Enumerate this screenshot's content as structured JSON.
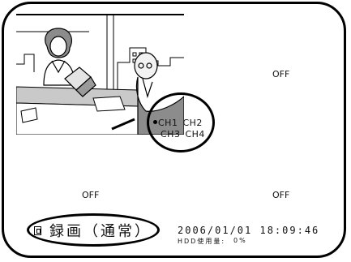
{
  "channels": {
    "ch2_status": "OFF",
    "ch3_status": "OFF",
    "ch4_status": "OFF",
    "selector": {
      "ch1": "CH1",
      "ch2": "CH2",
      "ch3": "CH3",
      "ch4": "CH4",
      "active": "CH1"
    }
  },
  "recording": {
    "icon": "recording-mode-icon",
    "mode_label": "録画（通常）"
  },
  "status_bar": {
    "datetime": "2006/01/01 18:09:46",
    "hdd_label": "HDD使用量:",
    "hdd_value": "0%"
  }
}
